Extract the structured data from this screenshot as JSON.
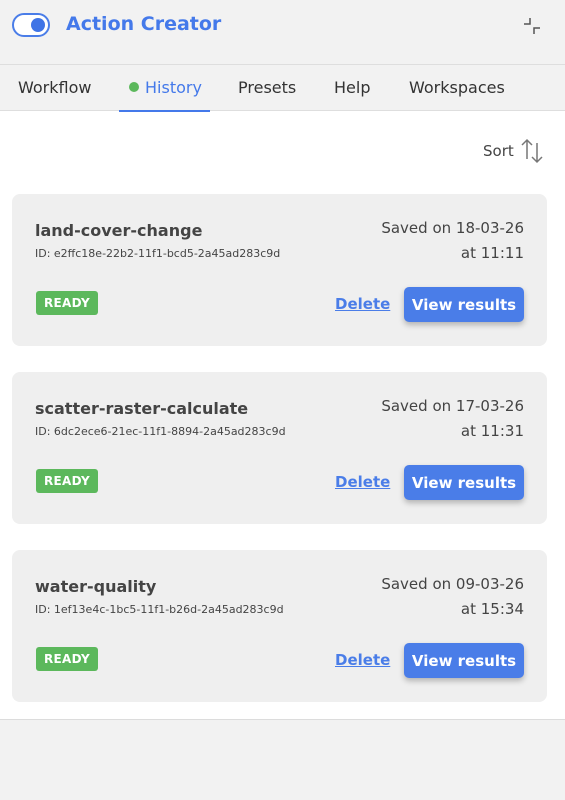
{
  "header": {
    "title": "Action Creator",
    "toggle_on": true
  },
  "tabs": [
    {
      "label": "Workflow",
      "active": false
    },
    {
      "label": "History",
      "active": true,
      "status": "green-dot"
    },
    {
      "label": "Presets",
      "active": false
    },
    {
      "label": "Help",
      "active": false
    },
    {
      "label": "Workspaces",
      "active": false
    }
  ],
  "sort": {
    "label": "Sort",
    "icon": "sort-arrows-icon"
  },
  "history": [
    {
      "name": "land-cover-change",
      "id": "ID: e2ffc18e-22b2-11f1-bcd5-2a45ad283c9d",
      "saved_line1": "Saved on 18-03-26",
      "saved_line2": "at 11:11",
      "status": "READY",
      "delete_label": "Delete",
      "view_label": "View results"
    },
    {
      "name": "scatter-raster-calculate",
      "id": "ID: 6dc2ece6-21ec-11f1-8894-2a45ad283c9d",
      "saved_line1": "Saved on 17-03-26",
      "saved_line2": "at 11:31",
      "status": "READY",
      "delete_label": "Delete",
      "view_label": "View results"
    },
    {
      "name": "water-quality",
      "id": "ID: 1ef13e4c-1bc5-11f1-b26d-2a45ad283c9d",
      "saved_line1": "Saved on 09-03-26",
      "saved_line2": "at 15:34",
      "status": "READY",
      "delete_label": "Delete",
      "view_label": "View results"
    }
  ],
  "colors": {
    "accent": "#4a7de8",
    "ready": "#5cb85c",
    "card_bg": "#efefef"
  }
}
